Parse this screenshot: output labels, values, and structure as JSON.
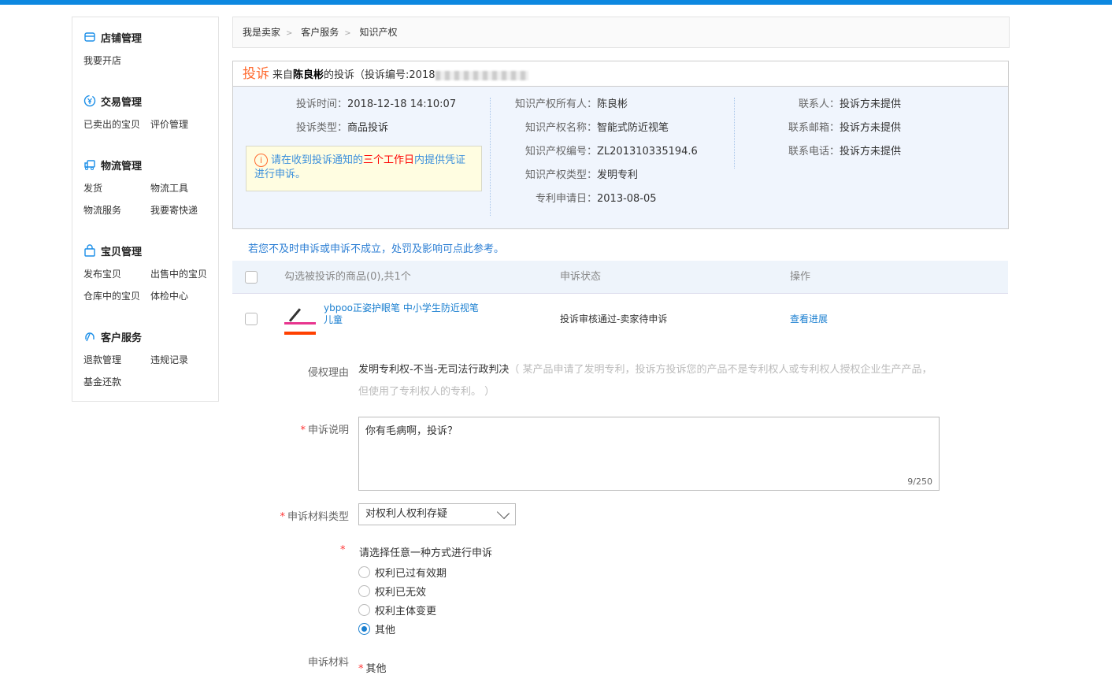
{
  "sidebar": {
    "groups": [
      {
        "title": "店铺管理",
        "icon": "shop-icon",
        "links": [
          "我要开店"
        ]
      },
      {
        "title": "交易管理",
        "icon": "yuan-icon",
        "links": [
          "已卖出的宝贝",
          "评价管理"
        ]
      },
      {
        "title": "物流管理",
        "icon": "truck-icon",
        "links": [
          "发货",
          "物流工具",
          "物流服务",
          "我要寄快递"
        ]
      },
      {
        "title": "宝贝管理",
        "icon": "bag-icon",
        "links": [
          "发布宝贝",
          "出售中的宝贝",
          "仓库中的宝贝",
          "体检中心"
        ]
      },
      {
        "title": "客户服务",
        "icon": "headset-icon",
        "links": [
          "退款管理",
          "违规记录",
          "基金还款"
        ]
      }
    ]
  },
  "breadcrumb": [
    "我是卖家",
    "客户服务",
    "知识产权"
  ],
  "complaint": {
    "head_big": "投诉",
    "head_from": "来自",
    "complainant": "陈良彬",
    "head_suffix": "的投诉（投诉编号:2018",
    "left": [
      {
        "label": "投诉时间：",
        "value": "2018-12-18 14:10:07"
      },
      {
        "label": "投诉类型：",
        "value": "商品投诉"
      }
    ],
    "tip": {
      "pre": "请在收到投诉通知的",
      "highlight": "三个工作日",
      "post": "内提供凭证进行申诉。"
    },
    "middle": [
      {
        "label": "知识产权所有人：",
        "value": "陈良彬"
      },
      {
        "label": "知识产权名称：",
        "value": "智能式防近视笔"
      },
      {
        "label": "知识产权编号：",
        "value": "ZL201310335194.6"
      },
      {
        "label": "知识产权类型：",
        "value": "发明专利"
      },
      {
        "label": "专利申请日：",
        "value": "2013-08-05"
      }
    ],
    "right": [
      {
        "label": "联系人：",
        "value": "投诉方未提供"
      },
      {
        "label": "联系邮箱：",
        "value": "投诉方未提供"
      },
      {
        "label": "联系电话：",
        "value": "投诉方未提供"
      }
    ]
  },
  "notice": "若您不及时申诉或申诉不成立，处罚及影响可点此参考。",
  "table": {
    "headers": [
      "勾选被投诉的商品(0),共1个",
      "申诉状态",
      "操作"
    ],
    "rows": [
      {
        "product": "ybpoo正姿护眼笔 中小学生防近视笔儿童",
        "status": "投诉审核通过-卖家待申诉",
        "action": "查看进展"
      }
    ]
  },
  "form": {
    "reason_label": "侵权理由",
    "reason_value": "发明专利权-不当-无司法行政判决",
    "reason_note": "（ 某产品申请了发明专利，投诉方投诉您的产品不是专利权人或专利权人授权企业生产产品，但使用了专利权人的专利。 ）",
    "desc_label": "申诉说明",
    "desc_value": "你有毛病啊，投诉？",
    "desc_count": "9/250",
    "type_label": "申诉材料类型",
    "type_value": "对权利人权利存疑",
    "method_label": "请选择任意一种方式进行申诉",
    "options": [
      "权利已过有效期",
      "权利已无效",
      "权利主体变更",
      "其他"
    ],
    "selected": 3,
    "material_label": "申诉材料",
    "material_sub": "其他"
  }
}
